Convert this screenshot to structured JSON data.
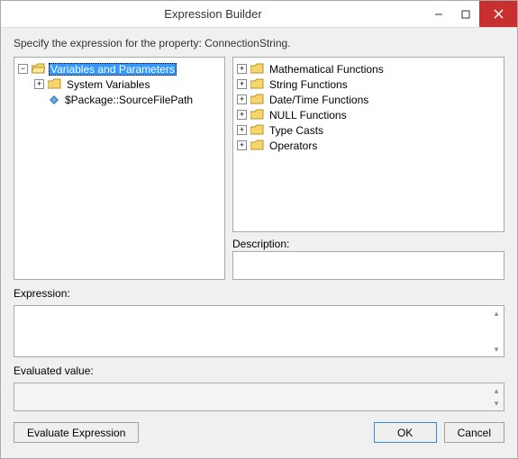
{
  "title": "Expression Builder",
  "instruction": "Specify the expression for the property: ConnectionString.",
  "leftTree": {
    "root": {
      "label": "Variables and Parameters",
      "selected": true
    },
    "child1": {
      "label": "System Variables"
    },
    "child2": {
      "label": "$Package::SourceFilePath"
    }
  },
  "rightTree": {
    "n0": {
      "label": "Mathematical Functions"
    },
    "n1": {
      "label": "String Functions"
    },
    "n2": {
      "label": "Date/Time Functions"
    },
    "n3": {
      "label": "NULL Functions"
    },
    "n4": {
      "label": "Type Casts"
    },
    "n5": {
      "label": "Operators"
    }
  },
  "labels": {
    "description": "Description:",
    "expression": "Expression:",
    "evaluated": "Evaluated value:"
  },
  "buttons": {
    "eval": "Evaluate Expression",
    "ok": "OK",
    "cancel": "Cancel"
  }
}
